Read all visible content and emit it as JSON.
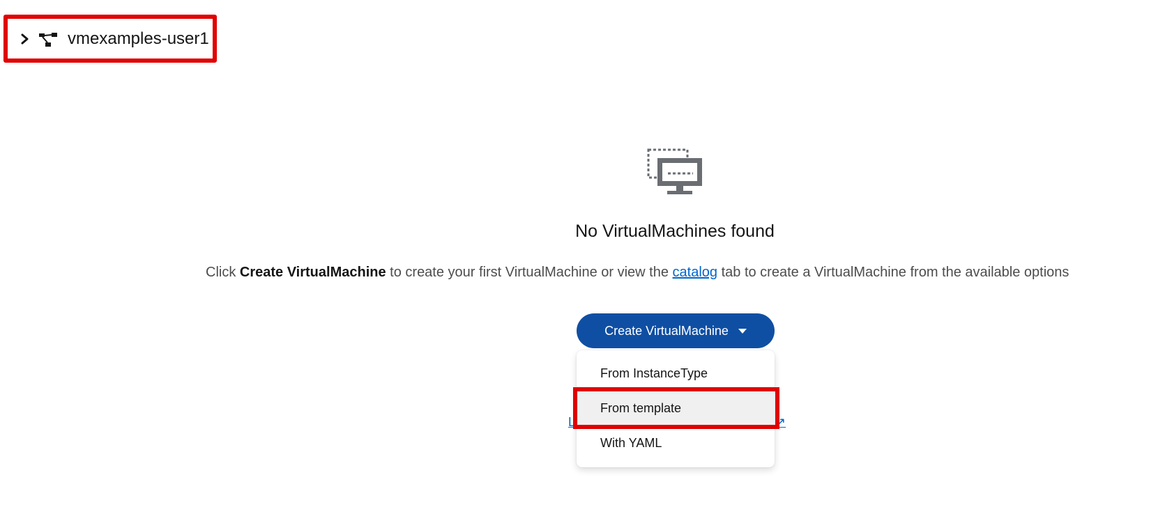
{
  "project": {
    "name": "vmexamples-user1",
    "expand_icon": "chevron-right-icon",
    "type_icon": "project-topology-icon"
  },
  "empty_state": {
    "icon": "virtual-machine-icon",
    "title": "No VirtualMachines found",
    "body_prefix": "Click ",
    "body_bold": "Create VirtualMachine",
    "body_middle": " to create your first VirtualMachine or view the ",
    "body_link": "catalog",
    "body_suffix": " tab to create a VirtualMachine from the available options"
  },
  "create_button": {
    "label": "Create VirtualMachine",
    "icon": "caret-down-icon"
  },
  "menu": {
    "items": [
      {
        "label": "From InstanceType"
      },
      {
        "label": "From template"
      },
      {
        "label": "With YAML"
      }
    ]
  },
  "colors": {
    "primary": "#0f4fa3",
    "link": "#0066cc",
    "annotation": "#e00000"
  }
}
